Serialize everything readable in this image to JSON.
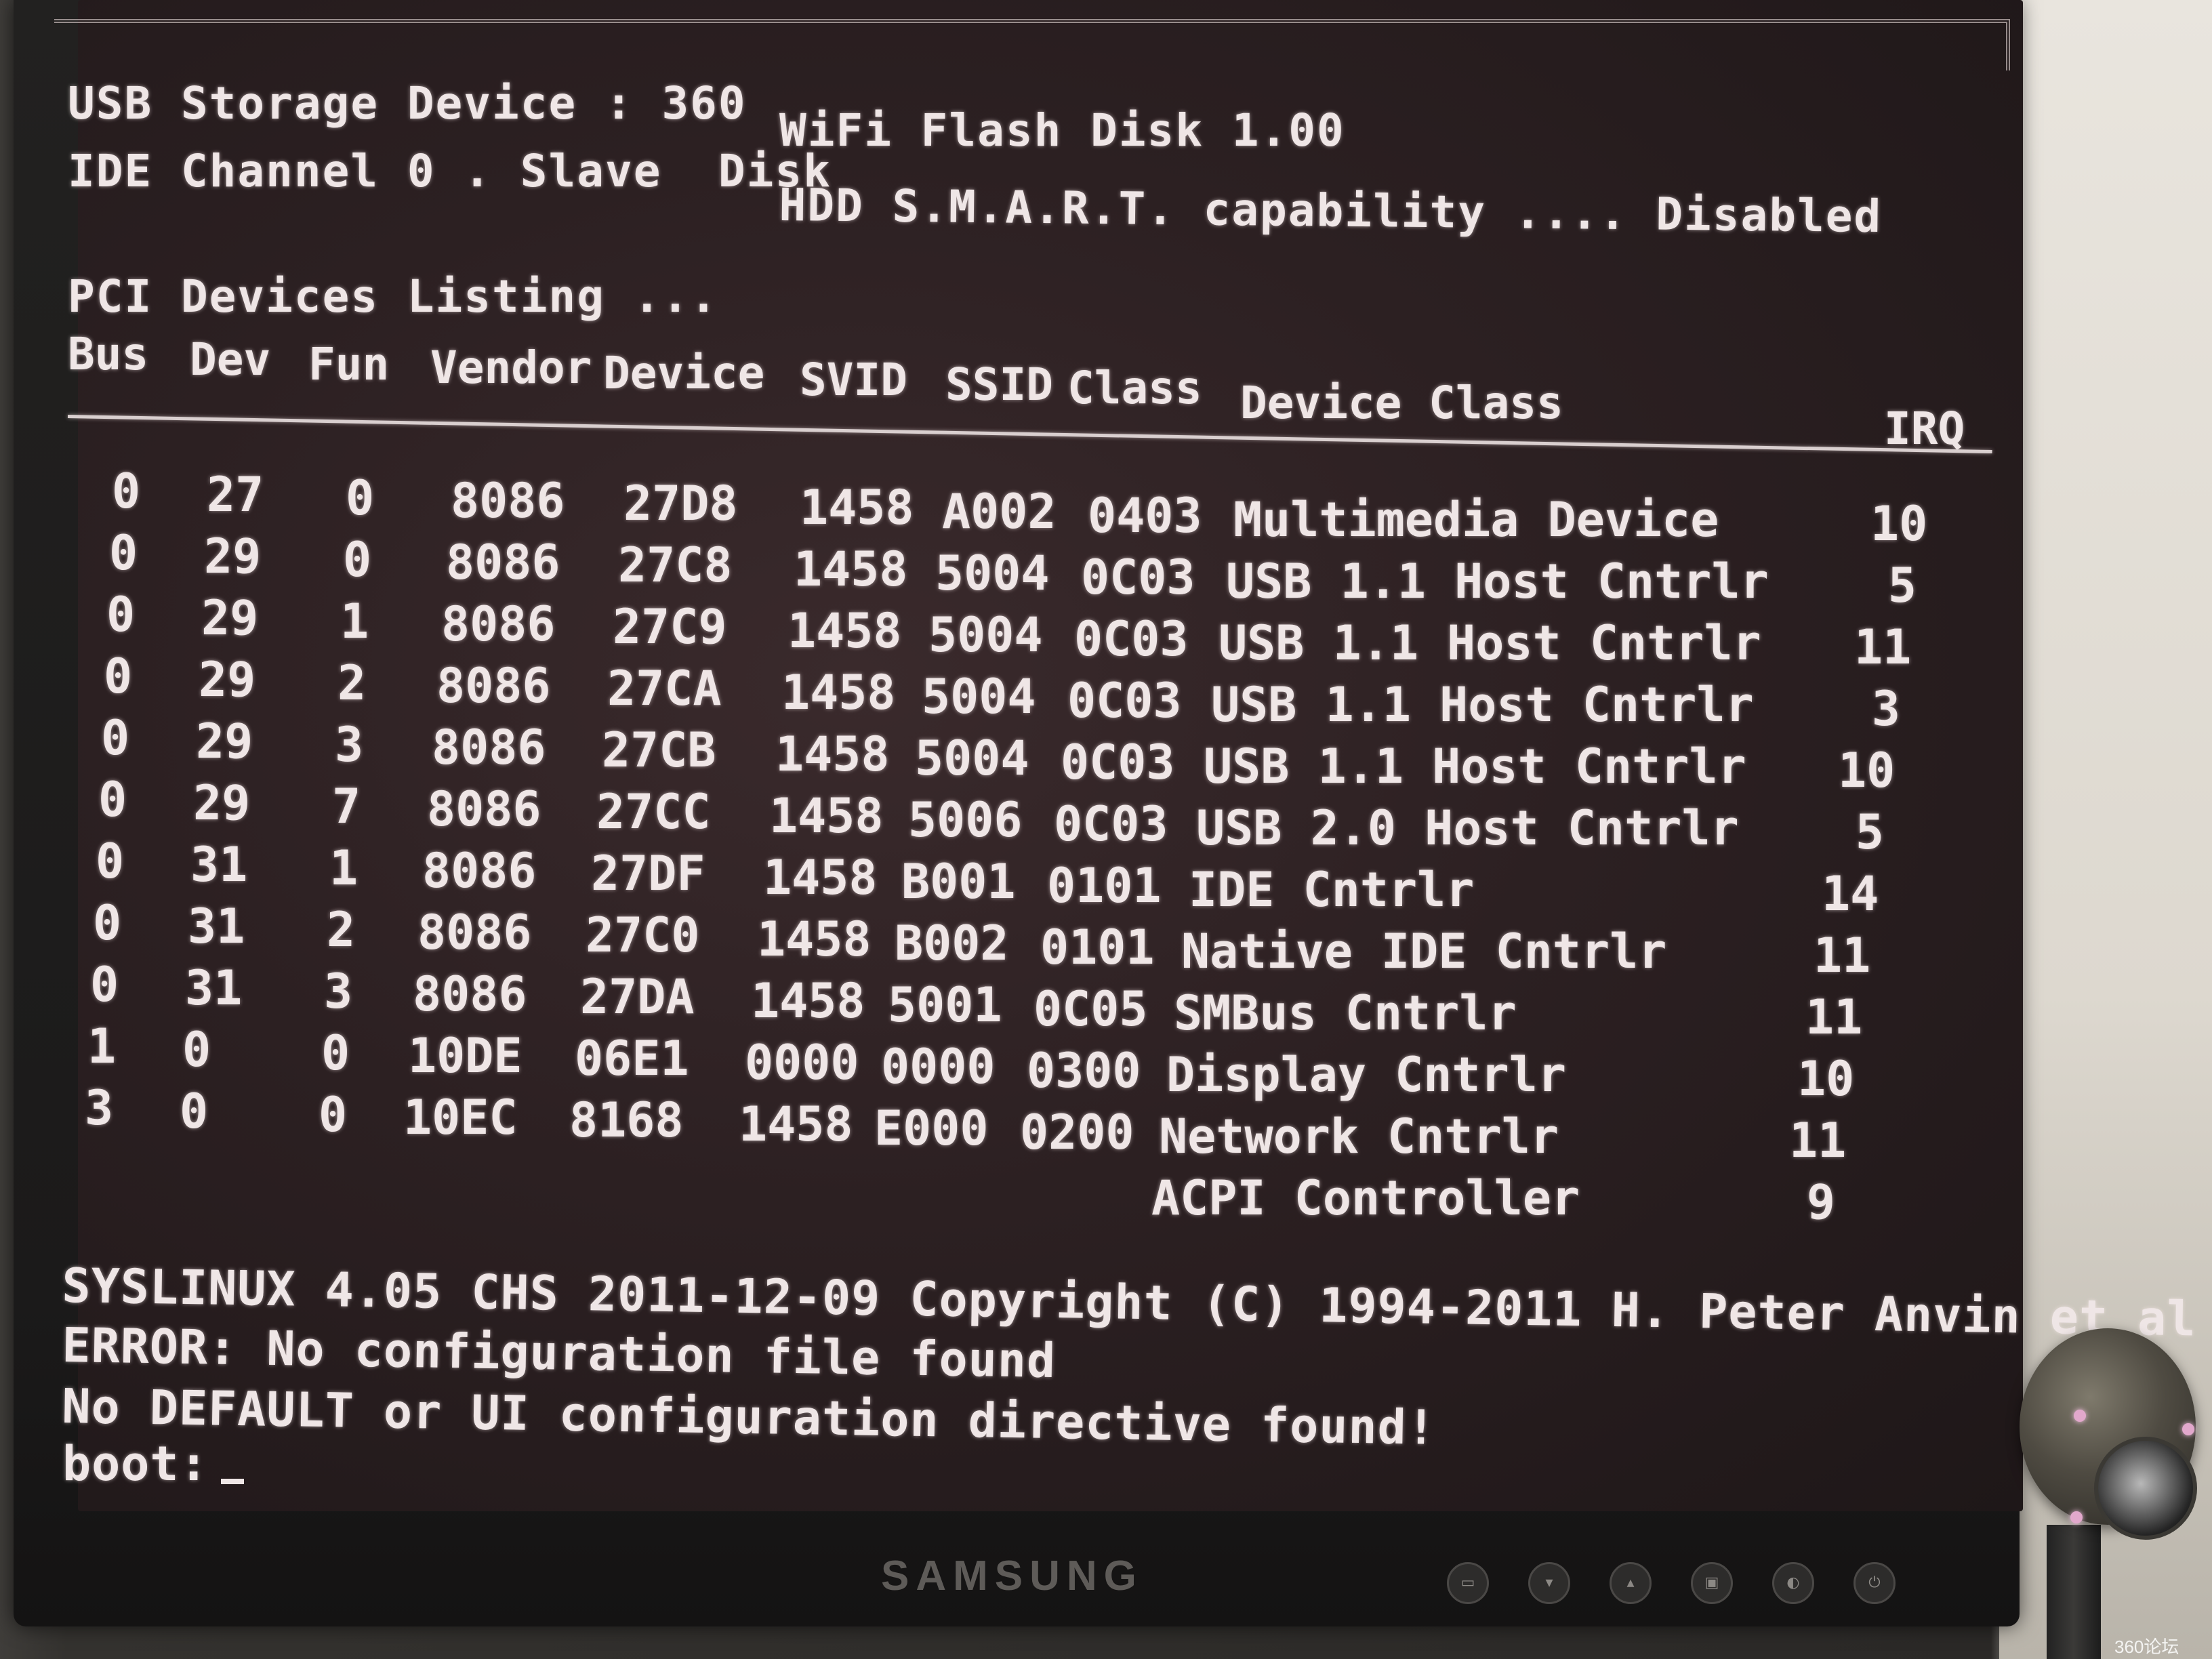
{
  "header": {
    "usb_line_left": "USB Storage Device : 360",
    "usb_line_right": "WiFi Flash Disk 1.00",
    "ide_line_left": "IDE Channel 0 . Slave  Disk",
    "ide_line_right": "HDD S.M.A.R.T. capability .... Disabled"
  },
  "pci": {
    "title": "PCI Devices Listing ...",
    "columns": {
      "bus": "Bus",
      "dev": "Dev",
      "fun": "Fun",
      "vendor": "Vendor",
      "device": "Device",
      "svid": "SVID",
      "ssid": "SSID",
      "class": "Class",
      "device_class": "Device Class",
      "irq": "IRQ"
    },
    "rows": [
      {
        "bus": "0",
        "dev": "27",
        "fun": "0",
        "vendor": "8086",
        "device": "27D8",
        "svid": "1458",
        "ssid": "A002",
        "class": "0403",
        "device_class": "Multimedia Device",
        "irq": "10"
      },
      {
        "bus": "0",
        "dev": "29",
        "fun": "0",
        "vendor": "8086",
        "device": "27C8",
        "svid": "1458",
        "ssid": "5004",
        "class": "0C03",
        "device_class": "USB 1.1 Host Cntrlr",
        "irq": "5"
      },
      {
        "bus": "0",
        "dev": "29",
        "fun": "1",
        "vendor": "8086",
        "device": "27C9",
        "svid": "1458",
        "ssid": "5004",
        "class": "0C03",
        "device_class": "USB 1.1 Host Cntrlr",
        "irq": "11"
      },
      {
        "bus": "0",
        "dev": "29",
        "fun": "2",
        "vendor": "8086",
        "device": "27CA",
        "svid": "1458",
        "ssid": "5004",
        "class": "0C03",
        "device_class": "USB 1.1 Host Cntrlr",
        "irq": "3"
      },
      {
        "bus": "0",
        "dev": "29",
        "fun": "3",
        "vendor": "8086",
        "device": "27CB",
        "svid": "1458",
        "ssid": "5004",
        "class": "0C03",
        "device_class": "USB 1.1 Host Cntrlr",
        "irq": "10"
      },
      {
        "bus": "0",
        "dev": "29",
        "fun": "7",
        "vendor": "8086",
        "device": "27CC",
        "svid": "1458",
        "ssid": "5006",
        "class": "0C03",
        "device_class": "USB 2.0 Host Cntrlr",
        "irq": "5"
      },
      {
        "bus": "0",
        "dev": "31",
        "fun": "1",
        "vendor": "8086",
        "device": "27DF",
        "svid": "1458",
        "ssid": "B001",
        "class": "0101",
        "device_class": "IDE Cntrlr",
        "irq": "14"
      },
      {
        "bus": "0",
        "dev": "31",
        "fun": "2",
        "vendor": "8086",
        "device": "27C0",
        "svid": "1458",
        "ssid": "B002",
        "class": "0101",
        "device_class": "Native IDE Cntrlr",
        "irq": "11"
      },
      {
        "bus": "0",
        "dev": "31",
        "fun": "3",
        "vendor": "8086",
        "device": "27DA",
        "svid": "1458",
        "ssid": "5001",
        "class": "0C05",
        "device_class": "SMBus Cntrlr",
        "irq": "11"
      },
      {
        "bus": "1",
        "dev": "0",
        "fun": "0",
        "vendor": "10DE",
        "device": "06E1",
        "svid": "0000",
        "ssid": "0000",
        "class": "0300",
        "device_class": "Display Cntrlr",
        "irq": "10"
      },
      {
        "bus": "3",
        "dev": "0",
        "fun": "0",
        "vendor": "10EC",
        "device": "8168",
        "svid": "1458",
        "ssid": "E000",
        "class": "0200",
        "device_class": "Network Cntrlr",
        "irq": "11"
      }
    ],
    "acpi": {
      "device_class": "ACPI Controller",
      "irq": "9"
    }
  },
  "boot": {
    "line1": "SYSLINUX 4.05 CHS 2011-12-09 Copyright (C) 1994-2011 H. Peter Anvin et al",
    "line2": "ERROR: No configuration file found",
    "line3": "No DEFAULT or UI configuration directive found!",
    "prompt": "boot:"
  },
  "monitor": {
    "brand": "SAMSUNG"
  },
  "watermark": "360论坛"
}
